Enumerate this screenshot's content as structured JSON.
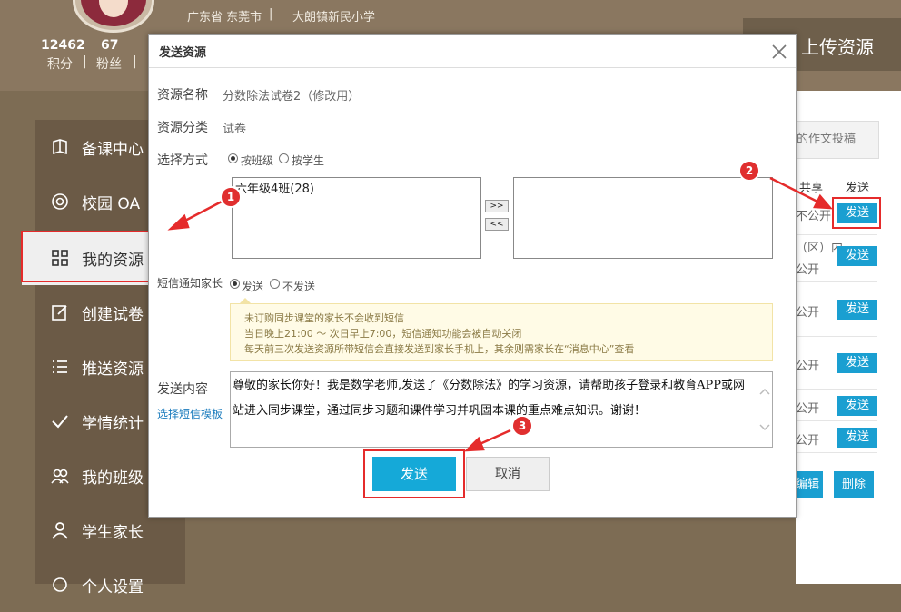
{
  "profile": {
    "province_city": "广东省 东莞市",
    "school": "大朗镇新民小学",
    "points": "12462",
    "points_label": "积分",
    "fans": "67",
    "fans_label": "粉丝",
    "divider": "|"
  },
  "header": {
    "upload_label": "上传资源"
  },
  "sidebar": {
    "items": [
      {
        "label": "备课中心",
        "icon": "book-icon"
      },
      {
        "label": "校园 OA",
        "icon": "at-icon"
      },
      {
        "label": "我的资源",
        "icon": "grid-icon",
        "active": true
      },
      {
        "label": "创建试卷",
        "icon": "edit-icon"
      },
      {
        "label": "推送资源",
        "icon": "list-icon"
      },
      {
        "label": "学情统计",
        "icon": "check-icon"
      },
      {
        "label": "我的班级",
        "icon": "users-icon"
      },
      {
        "label": "学生家长",
        "icon": "user-icon"
      },
      {
        "label": "个人设置",
        "icon": "settings-icon"
      }
    ]
  },
  "right_panel": {
    "contribute_label": "的作文投稿",
    "col_share": "共享",
    "col_send": "发送",
    "rows": [
      {
        "share": "不公开",
        "send": "发送"
      },
      {
        "share": "（区）内",
        "share2": "公开",
        "send": "发送"
      },
      {
        "share": "公开",
        "send": "发送"
      },
      {
        "share": "公开",
        "send": "发送"
      },
      {
        "share": "公开",
        "send": "发送"
      },
      {
        "share": "公开",
        "send": "发送"
      }
    ],
    "edit_label": "编辑",
    "delete_label": "删除"
  },
  "dialog": {
    "title": "发送资源",
    "resource_name_label": "资源名称",
    "resource_name": "分数除法试卷2（修改用）",
    "category_label": "资源分类",
    "category": "试卷",
    "method_label": "选择方式",
    "method_options": [
      "按班级",
      "按学生"
    ],
    "method_selected": "按班级",
    "class_list": [
      "六年级4班(28)"
    ],
    "move_right": ">>",
    "move_left": "<<",
    "sms_label": "短信通知家长",
    "sms_options": [
      "发送",
      "不发送"
    ],
    "sms_selected": "发送",
    "notice_lines": [
      "未订购同步课堂的家长不会收到短信",
      "当日晚上21:00 ～ 次日早上7:00，短信通知功能会被自动关闭",
      "每天前三次发送资源所带短信会直接发送到家长手机上，其余则需家长在“消息中心”查看"
    ],
    "content_label": "发送内容",
    "template_link": "选择短信模板",
    "message": "尊敬的家长你好！我是数学老师,发送了《分数除法》的学习资源，请帮助孩子登录和教育APP或网站进入同步课堂，通过同步习题和课件学习并巩固本课的重点难点知识。谢谢！",
    "send_label": "发送",
    "cancel_label": "取消"
  },
  "annotations": [
    "1",
    "2",
    "3"
  ],
  "colors": {
    "accent": "#15a9d8",
    "annotation": "#e02f2f",
    "sidebar_bg": "#6b5a46"
  }
}
